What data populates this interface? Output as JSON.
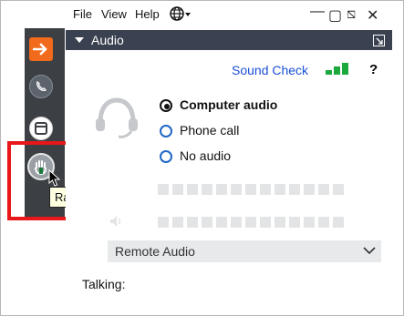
{
  "menubar": {
    "file": "File",
    "view": "View",
    "help": "Help",
    "globe_icon": "globe-icon",
    "minimize": "—",
    "restore": "▢",
    "resize": "⧅",
    "close": "✕"
  },
  "panel": {
    "title": "Audio"
  },
  "sound_check": "Sound Check",
  "help_symbol": "?",
  "options": [
    {
      "label": "Computer audio",
      "selected": true
    },
    {
      "label": "Phone call",
      "selected": false
    },
    {
      "label": "No audio",
      "selected": false
    }
  ],
  "speaker_select": {
    "value": "Remote Audio"
  },
  "talking_label": "Talking:",
  "tooltip": "Raise hand",
  "colors": {
    "toolbar_bg": "#3c3f44",
    "header_bg": "#3a4150",
    "accent_orange": "#f26a1b",
    "link_blue": "#1a4fd6",
    "highlight_red": "#e8171a",
    "level_green": "#1ba83c"
  }
}
